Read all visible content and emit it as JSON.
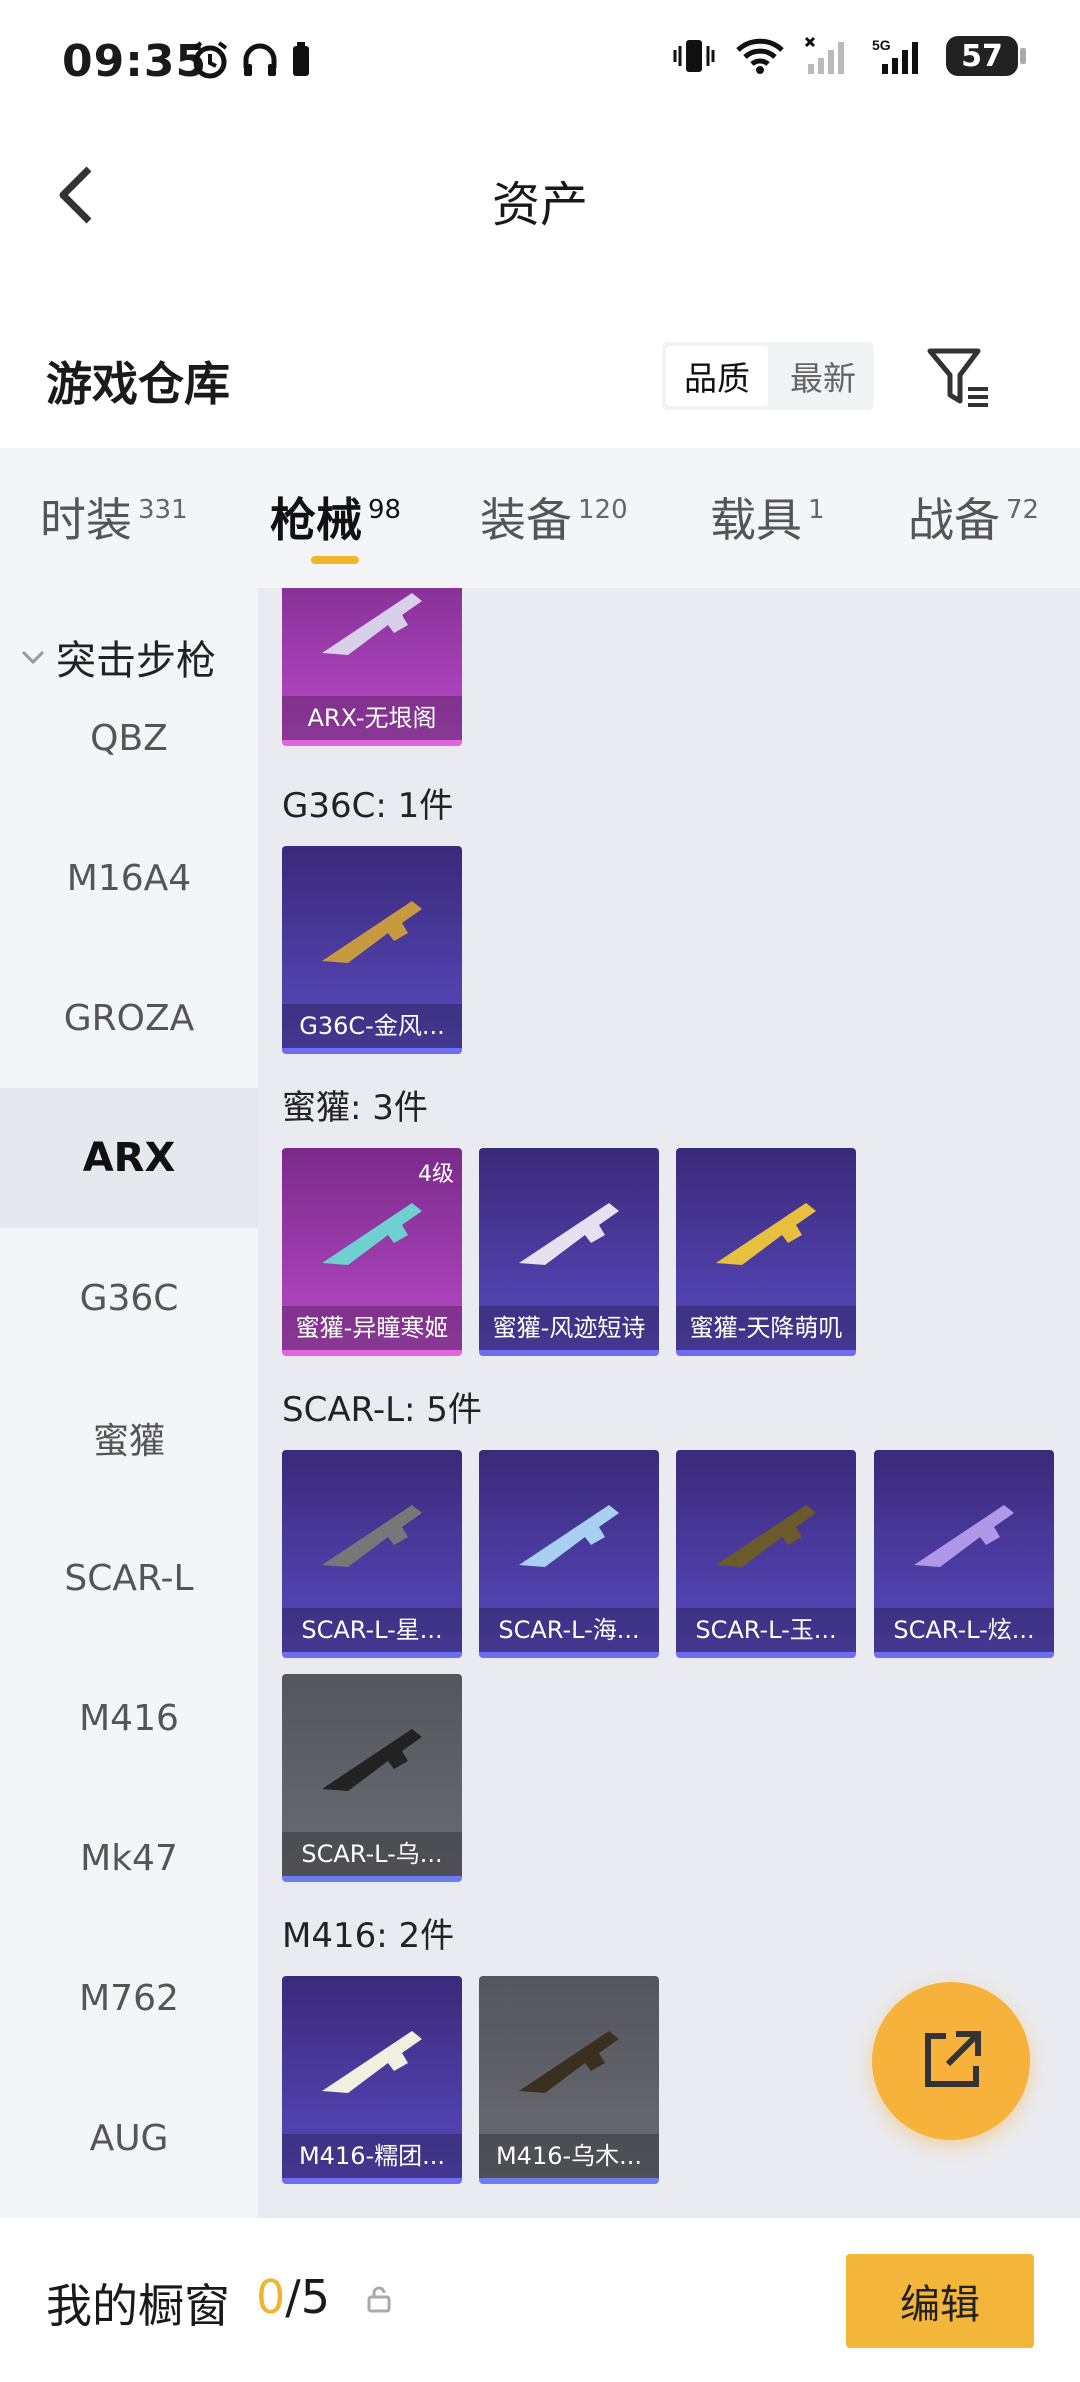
{
  "status_bar": {
    "time": "09:35",
    "battery": "57",
    "icons": [
      "alarm-icon",
      "headphones-icon",
      "battery-small-icon",
      "vibrate-icon",
      "wifi-icon",
      "signal-icon",
      "5g-signal-icon"
    ]
  },
  "header": {
    "title": "资产"
  },
  "warehouse": {
    "title": "游戏仓库",
    "sort_options": [
      "品质",
      "最新"
    ],
    "active_sort": "品质"
  },
  "tabs": [
    {
      "label": "时装",
      "count": "331"
    },
    {
      "label": "枪械",
      "count": "98"
    },
    {
      "label": "装备",
      "count": "120"
    },
    {
      "label": "载具",
      "count": "1"
    },
    {
      "label": "战备",
      "count": "72"
    }
  ],
  "active_tab": "枪械",
  "sidebar": {
    "group": "突击步枪",
    "items": [
      "QBZ",
      "M16A4",
      "GROZA",
      "ARX",
      "G36C",
      "蜜獾",
      "SCAR-L",
      "M416",
      "Mk47",
      "M762",
      "AUG"
    ],
    "active": "ARX"
  },
  "content": {
    "groups": [
      {
        "label": "",
        "items": [
          {
            "name": "ARX-无垠阁",
            "rarity": "magenta"
          }
        ]
      },
      {
        "label": "G36C: 1件",
        "items": [
          {
            "name": "G36C-金风...",
            "rarity": "purple"
          }
        ]
      },
      {
        "label": "蜜獾: 3件",
        "items": [
          {
            "name": "蜜獾-异瞳寒姬",
            "rarity": "magenta",
            "level": "4级"
          },
          {
            "name": "蜜獾-风迹短诗",
            "rarity": "purple"
          },
          {
            "name": "蜜獾-天降萌叽",
            "rarity": "purple"
          }
        ]
      },
      {
        "label": "SCAR-L: 5件",
        "items": [
          {
            "name": "SCAR-L-星...",
            "rarity": "purple"
          },
          {
            "name": "SCAR-L-海...",
            "rarity": "purple"
          },
          {
            "name": "SCAR-L-玉...",
            "rarity": "purple"
          },
          {
            "name": "SCAR-L-炫...",
            "rarity": "purple"
          },
          {
            "name": "SCAR-L-乌...",
            "rarity": "grey"
          }
        ]
      },
      {
        "label": "M416: 2件",
        "items": [
          {
            "name": "M416-糯团...",
            "rarity": "purple"
          },
          {
            "name": "M416-乌木...",
            "rarity": "grey"
          }
        ]
      }
    ]
  },
  "bottom_bar": {
    "label": "我的橱窗",
    "current": "0",
    "total": "/5",
    "edit_label": "编辑"
  },
  "colors": {
    "accent": "#f3b53a",
    "purple_card": "#4a3aa0",
    "magenta_card": "#9a38a8",
    "grey_card": "#5f6068"
  }
}
